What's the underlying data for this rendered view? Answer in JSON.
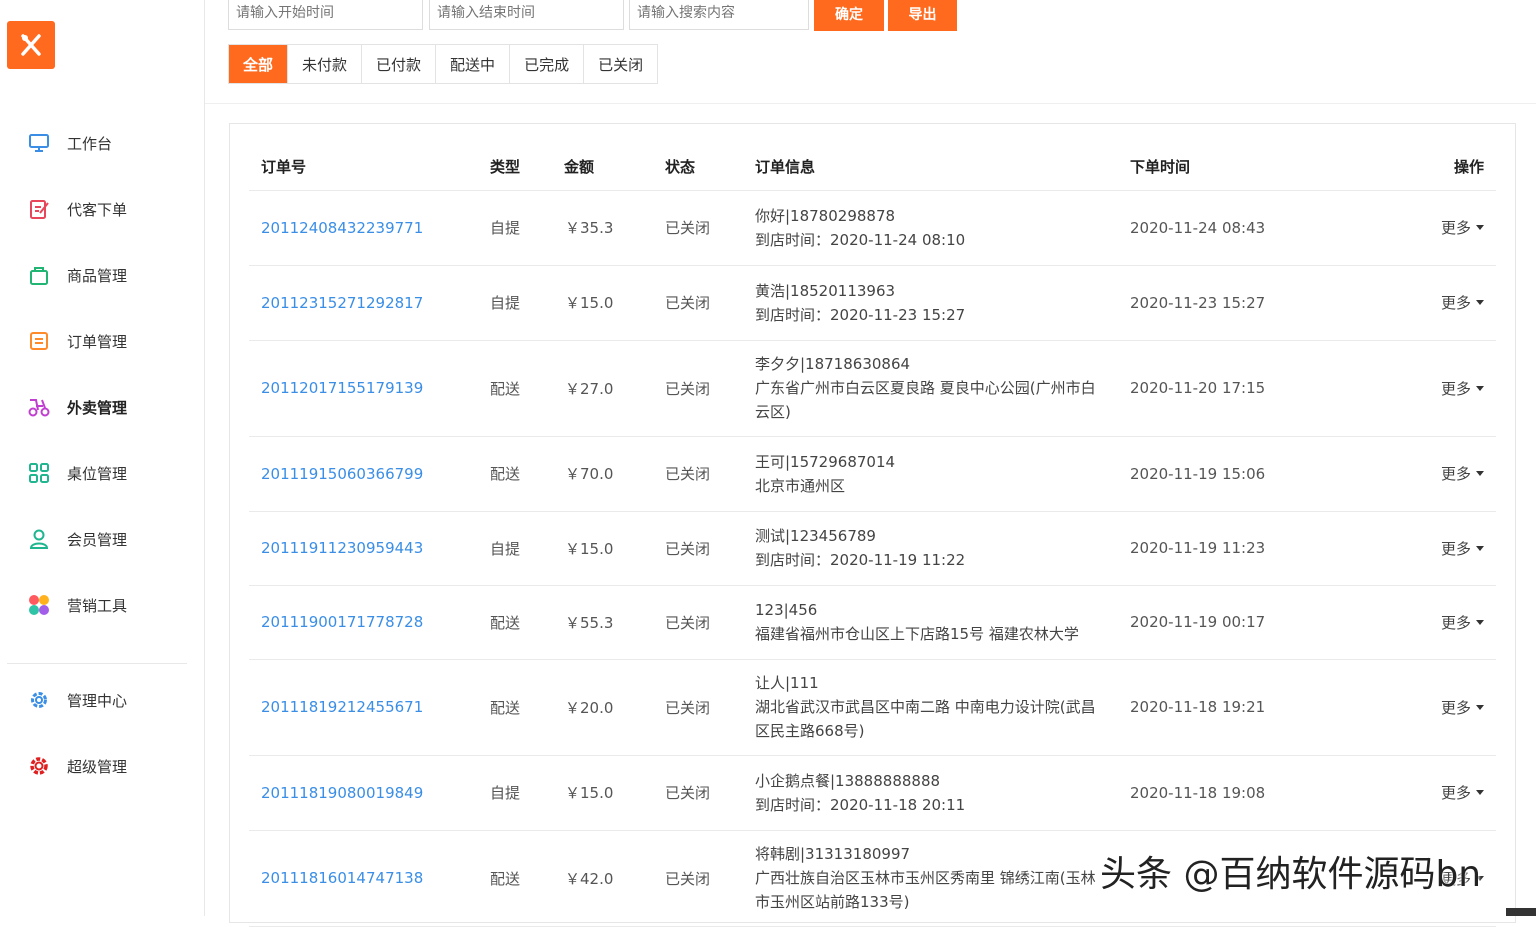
{
  "sidebar": {
    "items": [
      {
        "label": "工作台",
        "icon": "monitor-icon"
      },
      {
        "label": "代客下单",
        "icon": "edit-icon"
      },
      {
        "label": "商品管理",
        "icon": "bag-icon"
      },
      {
        "label": "订单管理",
        "icon": "list-icon"
      },
      {
        "label": "外卖管理",
        "icon": "scooter-icon"
      },
      {
        "label": "桌位管理",
        "icon": "grid-icon"
      },
      {
        "label": "会员管理",
        "icon": "user-icon"
      },
      {
        "label": "营销工具",
        "icon": "palette-icon"
      },
      {
        "label": "管理中心",
        "icon": "gear-icon"
      },
      {
        "label": "超级管理",
        "icon": "super-gear-icon"
      }
    ],
    "active_index": 4
  },
  "filters": {
    "start_placeholder": "请输入开始时间",
    "end_placeholder": "请输入结束时间",
    "search_placeholder": "请输入搜索内容",
    "confirm_label": "确定",
    "export_label": "导出"
  },
  "tabs": [
    "全部",
    "未付款",
    "已付款",
    "配送中",
    "已完成",
    "已关闭"
  ],
  "table": {
    "headers": {
      "order_no": "订单号",
      "type": "类型",
      "amount": "金额",
      "status": "状态",
      "info": "订单信息",
      "time": "下单时间",
      "action": "操作"
    },
    "more_label": "更多",
    "rows": [
      {
        "order_no": "20112408432239771",
        "type": "自提",
        "amount": "￥35.3",
        "status": "已关闭",
        "info1": "你好|18780298878",
        "info2": "到店时间：2020-11-24 08:10",
        "time": "2020-11-24 08:43"
      },
      {
        "order_no": "20112315271292817",
        "type": "自提",
        "amount": "￥15.0",
        "status": "已关闭",
        "info1": "黄浩|18520113963",
        "info2": "到店时间：2020-11-23 15:27",
        "time": "2020-11-23 15:27"
      },
      {
        "order_no": "20112017155179139",
        "type": "配送",
        "amount": "￥27.0",
        "status": "已关闭",
        "info1": "李夕夕|18718630864",
        "info2": "广东省广州市白云区夏良路 夏良中心公园(广州市白云区)",
        "time": "2020-11-20 17:15"
      },
      {
        "order_no": "20111915060366799",
        "type": "配送",
        "amount": "￥70.0",
        "status": "已关闭",
        "info1": "王可|15729687014",
        "info2": "北京市通州区",
        "time": "2020-11-19 15:06"
      },
      {
        "order_no": "20111911230959443",
        "type": "自提",
        "amount": "￥15.0",
        "status": "已关闭",
        "info1": "测试|123456789",
        "info2": "到店时间：2020-11-19 11:22",
        "time": "2020-11-19 11:23"
      },
      {
        "order_no": "20111900171778728",
        "type": "配送",
        "amount": "￥55.3",
        "status": "已关闭",
        "info1": "123|456",
        "info2": "福建省福州市仓山区上下店路15号 福建农林大学",
        "time": "2020-11-19 00:17"
      },
      {
        "order_no": "20111819212455671",
        "type": "配送",
        "amount": "￥20.0",
        "status": "已关闭",
        "info1": "让人|111",
        "info2": "湖北省武汉市武昌区中南二路 中南电力设计院(武昌区民主路668号)",
        "time": "2020-11-18 19:21"
      },
      {
        "order_no": "20111819080019849",
        "type": "自提",
        "amount": "￥15.0",
        "status": "已关闭",
        "info1": "小企鹅点餐|13888888888",
        "info2": "到店时间：2020-11-18 20:11",
        "time": "2020-11-18 19:08"
      },
      {
        "order_no": "20111816014747138",
        "type": "配送",
        "amount": "￥42.0",
        "status": "已关闭",
        "info1": "将韩剧|31313180997",
        "info2": "广西壮族自治区玉林市玉州区秀南里 锦绣江南(玉林市玉州区站前路133号)",
        "time": ""
      }
    ]
  },
  "watermark": "头条 @百纳软件源码bn",
  "colors": {
    "accent": "#ff6a1e",
    "link": "#3a8ee6"
  }
}
